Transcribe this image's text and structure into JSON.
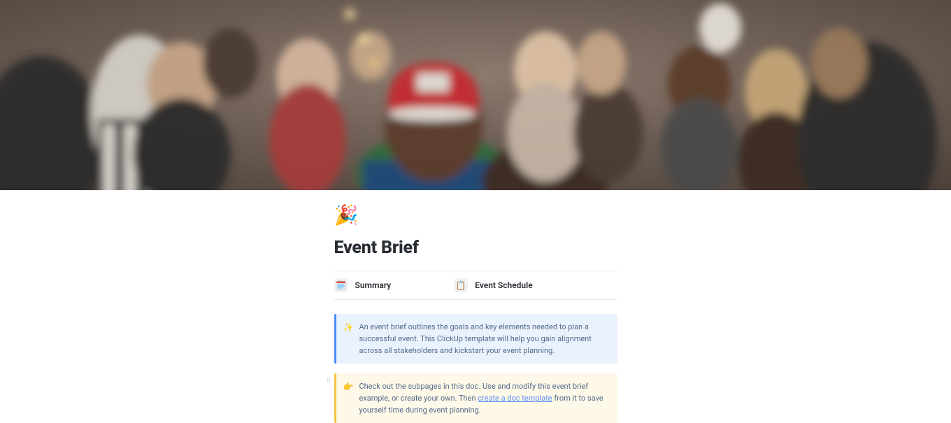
{
  "page": {
    "emoji": "🎉",
    "title": "Event Brief"
  },
  "subpages": [
    {
      "icon": "🗓️",
      "label": "Summary"
    },
    {
      "icon": "📋",
      "label": "Event Schedule"
    }
  ],
  "callouts": {
    "blue": {
      "emoji": "✨",
      "text": "An event brief outlines the goals and key elements needed to plan a successful event. This ClickUp template will help you gain alignment across all stakeholders and kickstart your event planning."
    },
    "yellow": {
      "emoji": "👉",
      "text_before": "Check out the subpages in this doc. Use and modify this event brief example, or create your own. Then ",
      "link_text": "create a doc template",
      "text_after": " from it to save yourself time during event planning."
    }
  }
}
